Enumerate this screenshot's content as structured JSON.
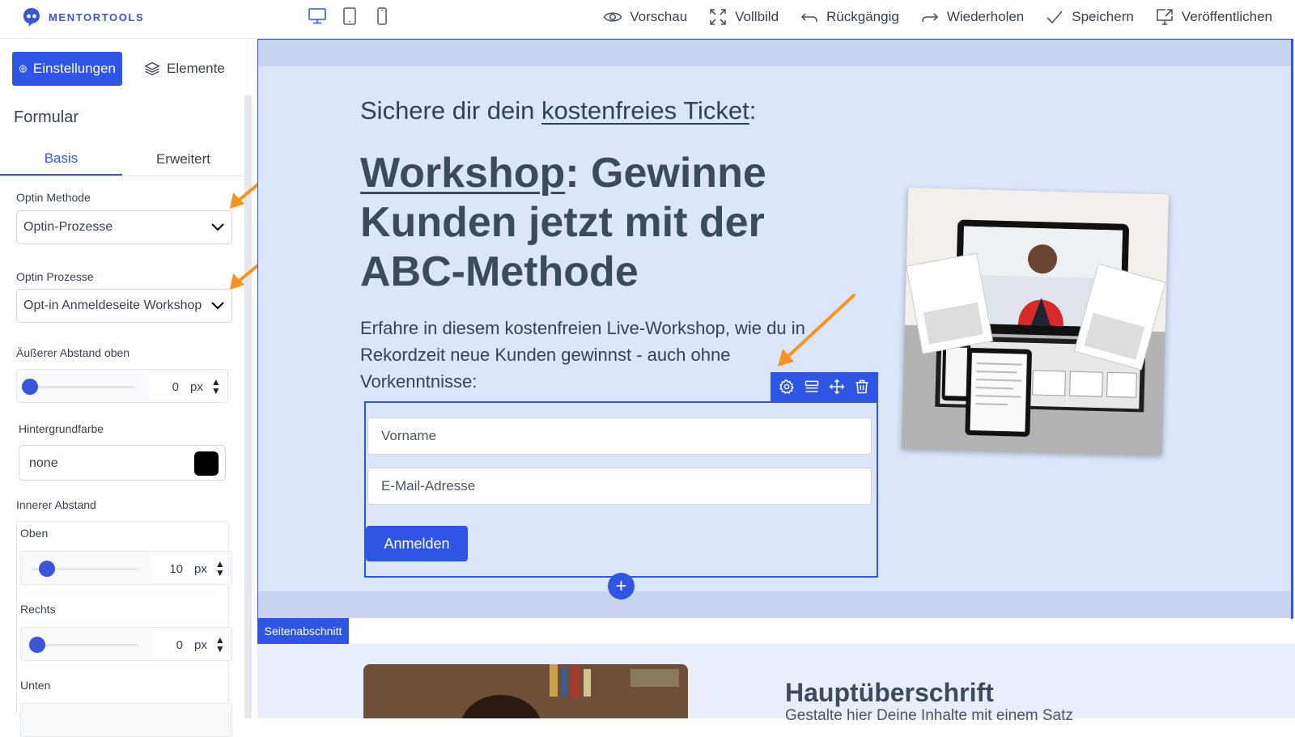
{
  "app": {
    "brand": "MENTORTOOLS",
    "accent": "#2f55e4"
  },
  "topbar": {
    "devices": [
      "desktop-icon",
      "tablet-icon",
      "phone-icon"
    ],
    "actions": [
      {
        "icon": "eye-icon",
        "label": "Vorschau"
      },
      {
        "icon": "fullscreen-icon",
        "label": "Vollbild"
      },
      {
        "icon": "undo-icon",
        "label": "Rückgängig"
      },
      {
        "icon": "redo-icon",
        "label": "Wiederholen"
      },
      {
        "icon": "check-icon",
        "label": "Speichern"
      },
      {
        "icon": "publish-icon",
        "label": "Veröffentlichen"
      }
    ]
  },
  "sidebar": {
    "tabs": {
      "settings": "Einstellungen",
      "elements": "Elemente"
    },
    "section_title": "Formular",
    "subtabs": {
      "basic": "Basis",
      "advanced": "Erweitert"
    },
    "optin_method": {
      "label": "Optin Methode",
      "value": "Optin-Prozesse"
    },
    "optin_process": {
      "label": "Optin Prozesse",
      "value": "Opt-in Anmeldeseite Workshop"
    },
    "margin_top": {
      "label": "Äußerer Abstand oben",
      "value": "0",
      "unit": "px"
    },
    "background": {
      "label": "Hintergrundfarbe",
      "value": "none",
      "swatch": "#000000"
    },
    "padding": {
      "label": "Innerer Abstand",
      "top": {
        "label": "Oben",
        "value": "10",
        "unit": "px"
      },
      "right": {
        "label": "Rechts",
        "value": "0",
        "unit": "px"
      },
      "bottom": {
        "label": "Unten"
      }
    }
  },
  "canvas": {
    "kicker_prefix": "Sichere dir dein ",
    "kicker_link": "kostenfreies Ticket",
    "kicker_suffix": ":",
    "headline_link": "Workshop",
    "headline_rest": ": Gewinne Kunden jetzt mit der ABC-Methode",
    "description": "Erfahre in diesem kostenfreien Live-Workshop, wie du in Rekordzeit neue Kunden gewinnst - auch ohne Vorkenntnisse:",
    "form": {
      "first_name_placeholder": "Vorname",
      "email_placeholder": "E-Mail-Adresse",
      "submit_label": "Anmelden"
    },
    "add_symbol": "+",
    "section_badge": "Seitenabschnitt",
    "section2_heading": "Hauptüberschrift",
    "section2_text": "Gestalte hier Deine Inhalte mit einem Satz"
  }
}
